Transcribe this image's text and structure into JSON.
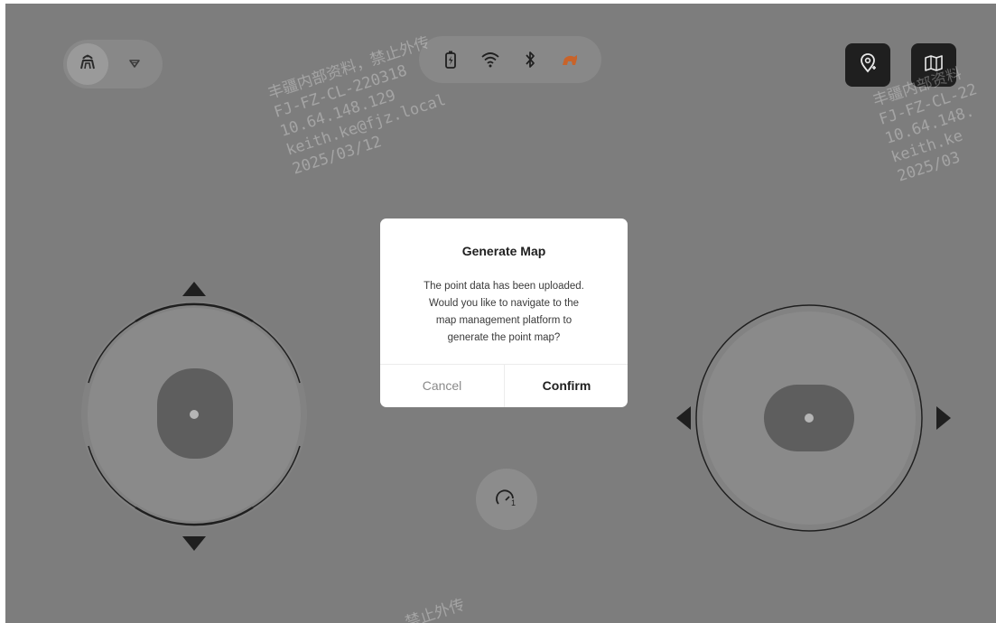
{
  "top_bar": {
    "left_pill": {
      "mode_icon": "robot-dog-icon",
      "dropdown_icon": "filter-triangle-icon"
    },
    "status": {
      "battery_icon": "battery-charging-icon",
      "wifi_icon": "wifi-icon",
      "bluetooth_icon": "bluetooth-icon",
      "robot_icon": "robot-status-icon",
      "robot_icon_color": "#c8632a"
    },
    "right_buttons": [
      {
        "icon": "location-add-icon"
      },
      {
        "icon": "map-edit-icon"
      }
    ]
  },
  "joysticks": {
    "left": {
      "icon_up": "arrow-up-icon",
      "icon_down": "arrow-down-icon"
    },
    "right": {
      "icon_left": "arrow-left-icon",
      "icon_right": "arrow-right-icon"
    }
  },
  "speed_button": {
    "icon": "speed-gauge-icon",
    "label": "1"
  },
  "watermark": {
    "lines_a": [
      "丰疆内部资料，禁止外传",
      "FJ-FZ-CL-220318",
      "10.64.148.129",
      "keith.ke@fjz.local",
      "2025/03/12"
    ],
    "lines_b": [
      "丰疆内部资料",
      "FJ-FZ-CL-22",
      "10.64.148.",
      "keith.ke",
      "2025/03"
    ],
    "footer": "禁止外传"
  },
  "dialog": {
    "title": "Generate Map",
    "body_lines": [
      "The point data has been uploaded.",
      "Would you like to navigate to the",
      "map management platform to",
      "generate the point map?"
    ],
    "cancel_label": "Cancel",
    "confirm_label": "Confirm"
  },
  "colors": {
    "overlay": "#7d7d7d",
    "dialog_bg": "#ffffff",
    "primary_text": "#1f1f1f",
    "muted_text": "#8a8a8a"
  }
}
